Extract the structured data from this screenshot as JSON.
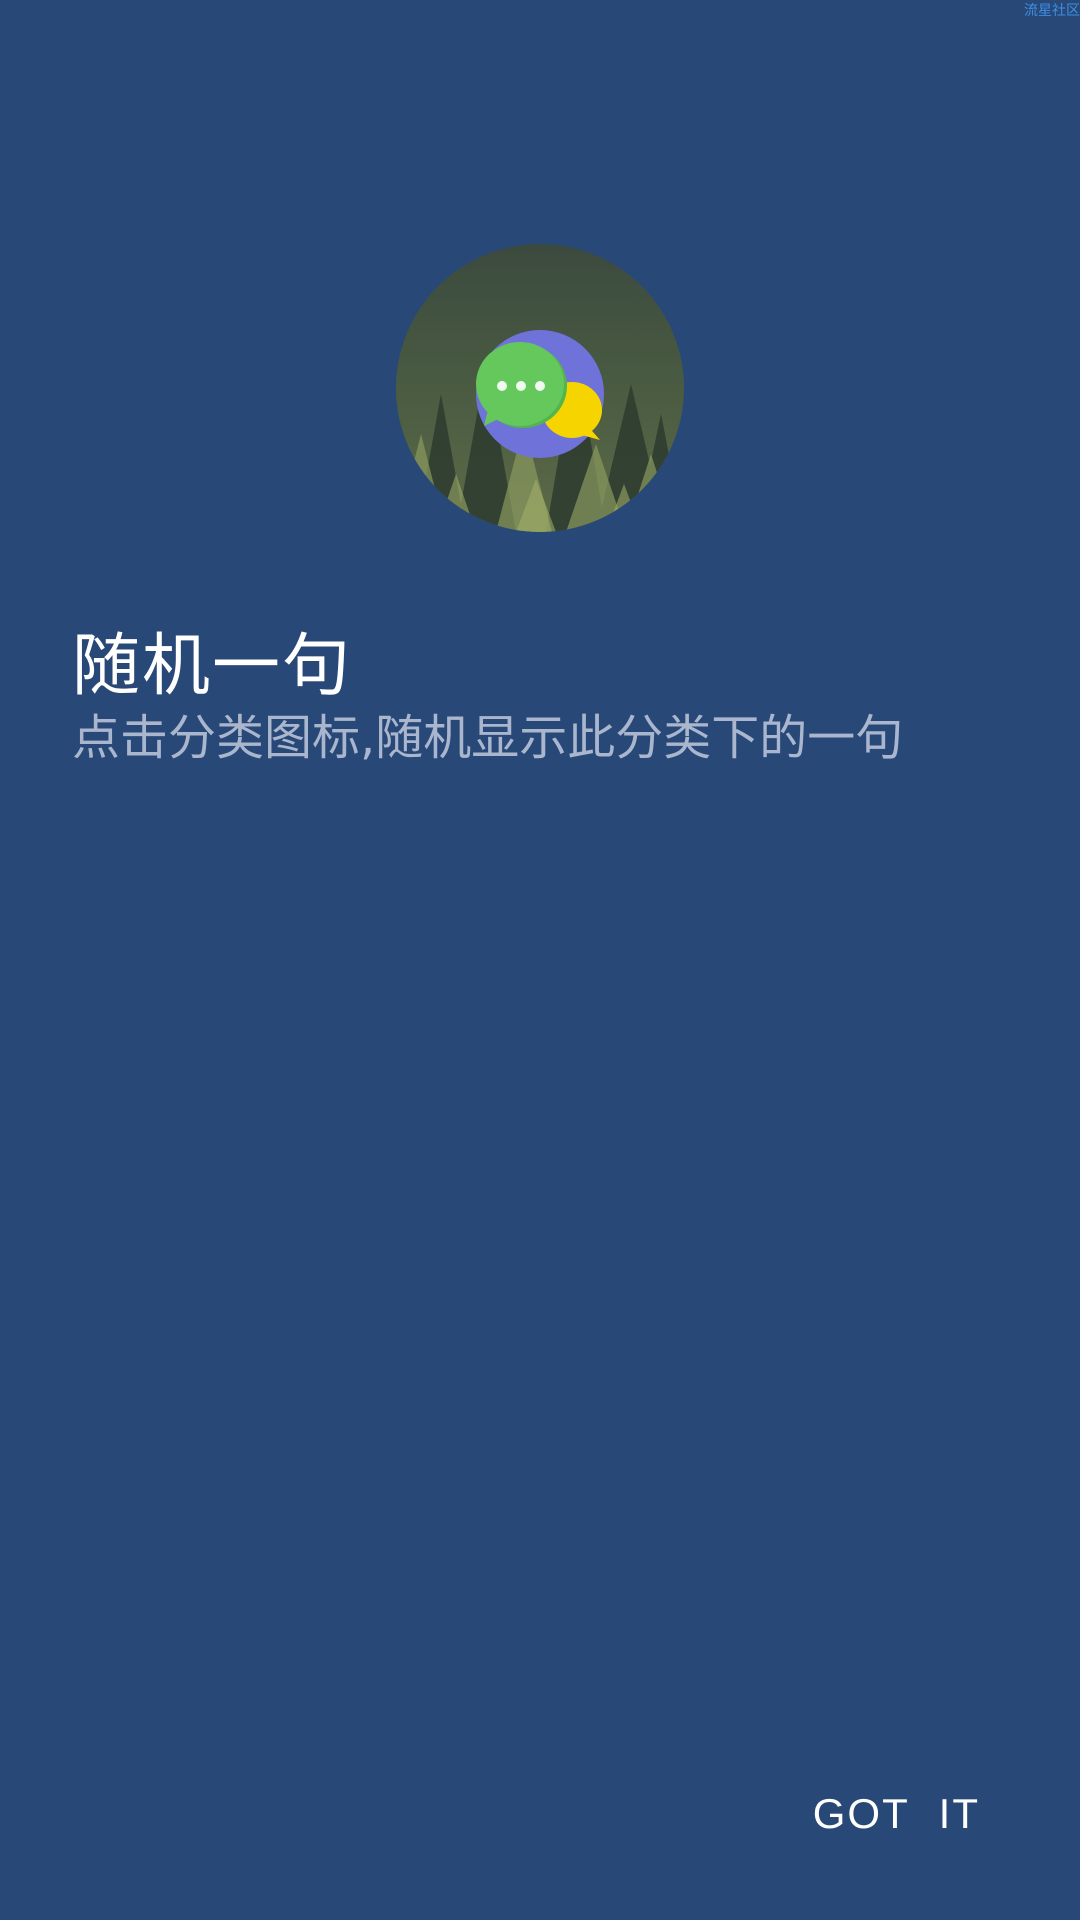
{
  "watermark": "流星社区",
  "showcase": {
    "icon": "chat-bubbles-icon",
    "title": "随机一句",
    "description": "点击分类图标,随机显示此分类下的一句"
  },
  "actions": {
    "dismiss_label": "GOT IT"
  },
  "colors": {
    "background": "#284878",
    "title": "#ffffff",
    "description": "#a9b6cd",
    "icon_circle": "#6f73d9",
    "bubble_green": "#64c85c",
    "bubble_yellow": "#f5d400"
  }
}
